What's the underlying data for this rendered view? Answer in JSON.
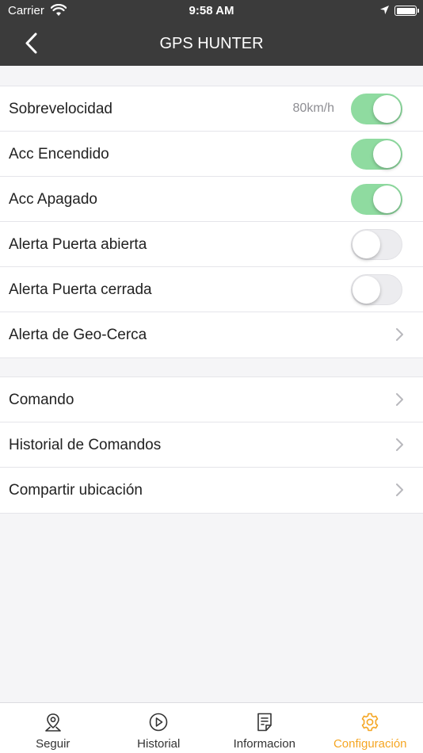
{
  "status_bar": {
    "carrier": "Carrier",
    "time": "9:58 AM"
  },
  "nav": {
    "title": "GPS HUNTER"
  },
  "group1": [
    {
      "label": "Sobrevelocidad",
      "detail": "80km/h",
      "toggle": true,
      "on": true
    },
    {
      "label": "Acc Encendido",
      "toggle": true,
      "on": true
    },
    {
      "label": "Acc Apagado",
      "toggle": true,
      "on": true
    },
    {
      "label": "Alerta Puerta abierta",
      "toggle": true,
      "on": false
    },
    {
      "label": "Alerta Puerta cerrada",
      "toggle": true,
      "on": false
    },
    {
      "label": "Alerta de Geo-Cerca",
      "toggle": false
    }
  ],
  "group2": [
    {
      "label": "Comando"
    },
    {
      "label": "Historial de Comandos"
    },
    {
      "label": "Compartir ubicación"
    }
  ],
  "tabs": [
    {
      "label": "Seguir",
      "icon": "map-pin-icon"
    },
    {
      "label": "Historial",
      "icon": "play-circle-icon"
    },
    {
      "label": "Informacion",
      "icon": "document-icon"
    },
    {
      "label": "Configuración",
      "icon": "gear-icon",
      "active": true
    }
  ],
  "colors": {
    "toggle_on": "#8fdba0",
    "active_tab": "#f5a623",
    "header": "#3b3b3b"
  }
}
